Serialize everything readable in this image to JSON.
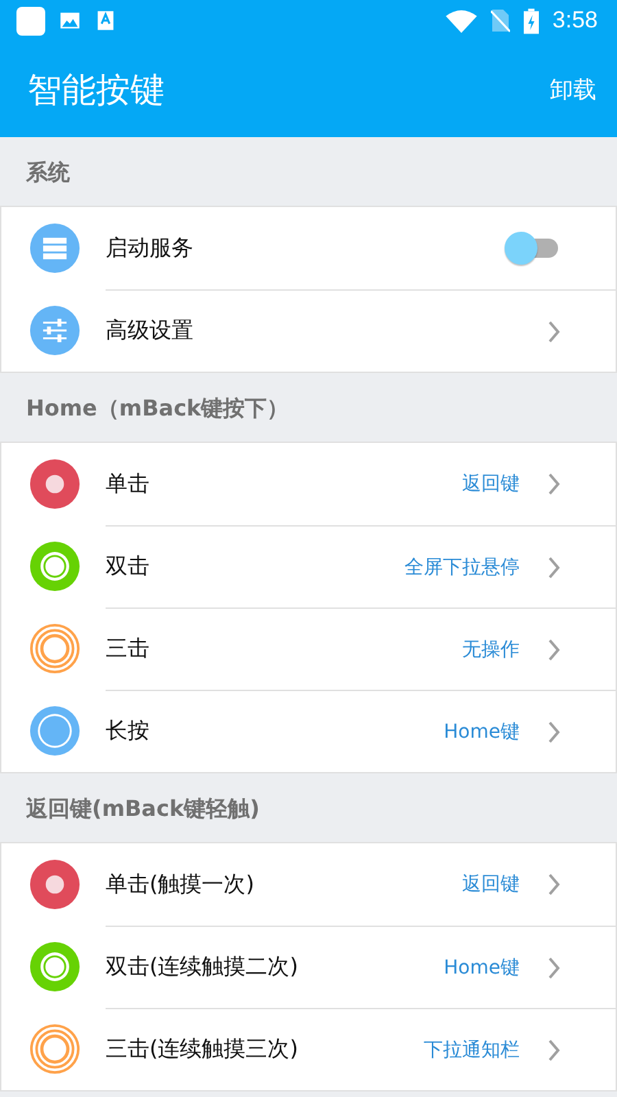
{
  "status_bar": {
    "time": "3:58"
  },
  "app_bar": {
    "title": "智能按键",
    "action": "卸载"
  },
  "sections": [
    {
      "title": "系统",
      "items": [
        {
          "kind": "toggle",
          "label": "启动服务",
          "on": false
        },
        {
          "kind": "link",
          "label": "高级设置"
        }
      ]
    },
    {
      "title": "Home（mBack键按下）",
      "items": [
        {
          "kind": "link",
          "label": "单击",
          "value": "返回键"
        },
        {
          "kind": "link",
          "label": "双击",
          "value": "全屏下拉悬停"
        },
        {
          "kind": "link",
          "label": "三击",
          "value": "无操作"
        },
        {
          "kind": "link",
          "label": "长按",
          "value": "Home键"
        }
      ]
    },
    {
      "title": "返回键(mBack键轻触)",
      "items": [
        {
          "kind": "link",
          "label": "单击(触摸一次)",
          "value": "返回键"
        },
        {
          "kind": "link",
          "label": "双击(连续触摸二次)",
          "value": "Home键"
        },
        {
          "kind": "link",
          "label": "三击(连续触摸三次)",
          "value": "下拉通知栏"
        }
      ]
    }
  ]
}
